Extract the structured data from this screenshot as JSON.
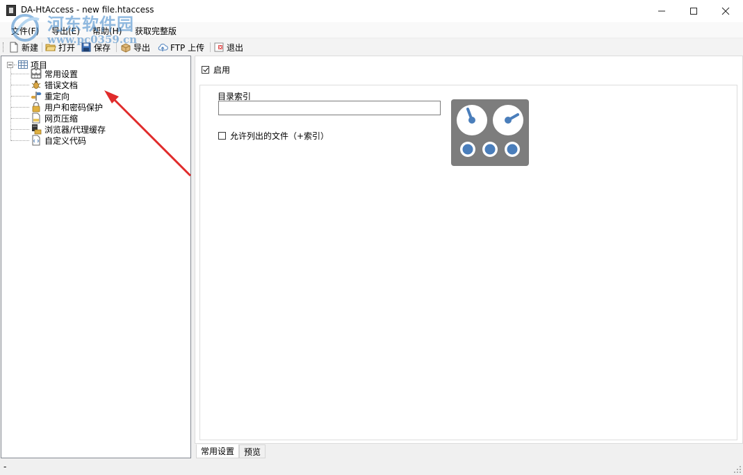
{
  "window": {
    "title": "DA-HtAccess - new file.htaccess",
    "minimize": "—",
    "maximize": "☐",
    "close": "✕"
  },
  "watermark": {
    "line1": "河东软件园",
    "line2": "www.pc0359.cn"
  },
  "menu": {
    "items": [
      "文件(F)",
      "导出(E)",
      "帮助(H)",
      "获取完整版"
    ]
  },
  "toolbar": {
    "new": "新建",
    "open": "打开",
    "save": "保存",
    "export": "导出",
    "ftp_upload": "FTP 上传",
    "exit": "退出"
  },
  "tree": {
    "root": "项目",
    "items": [
      {
        "label": "常用设置",
        "icon": "gauges-icon"
      },
      {
        "label": "错误文档",
        "icon": "error-bug-icon"
      },
      {
        "label": "重定向",
        "icon": "signpost-icon"
      },
      {
        "label": "用户和密码保护",
        "icon": "lock-icon"
      },
      {
        "label": "网页压缩",
        "icon": "zip-file-icon"
      },
      {
        "label": "浏览器/代理缓存",
        "icon": "cache-server-icon"
      },
      {
        "label": "自定义代码",
        "icon": "code-file-icon"
      }
    ]
  },
  "settings": {
    "enable_label": "启用",
    "enable_checked": true,
    "dir_index_label": "目录索引",
    "dir_index_value": "",
    "allow_listing_label": "允许列出的文件（+索引）",
    "allow_listing_checked": false
  },
  "tabs": [
    "常用设置",
    "预览"
  ],
  "status": {
    "text": "-"
  },
  "colors": {
    "gauge_bg": "#7d7d7d",
    "gauge_accent": "#4a7ebb",
    "arrow": "#e02b2b"
  }
}
